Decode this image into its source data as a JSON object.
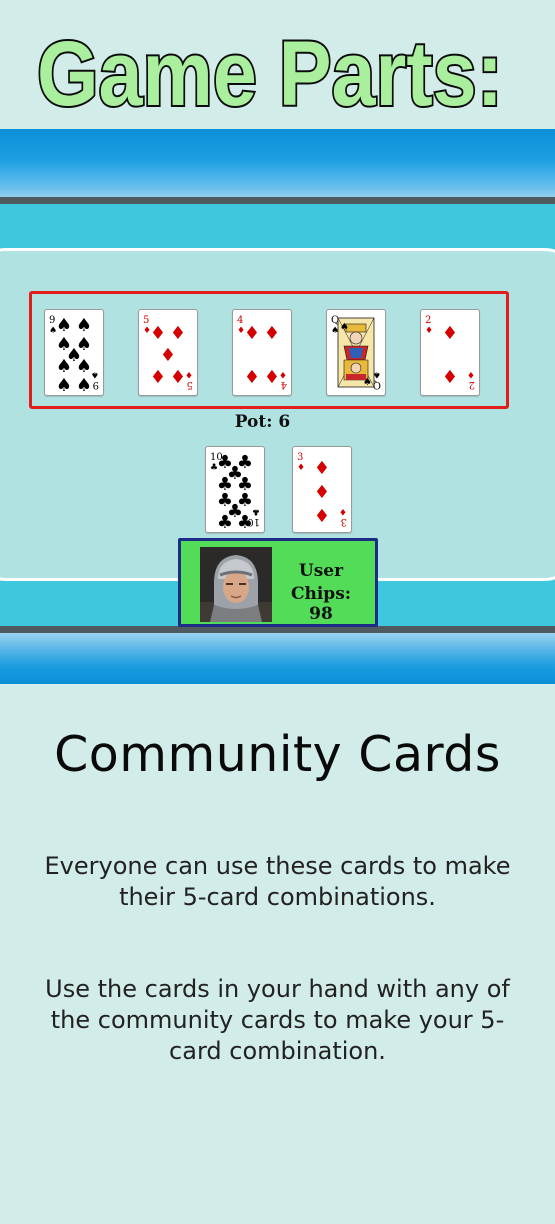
{
  "page": {
    "title": "Game Parts:"
  },
  "table": {
    "pot_label": "Pot: 6",
    "community_cards": [
      {
        "rank": "9",
        "suit": "spades",
        "suit_symbol": "♠",
        "color": "#000000"
      },
      {
        "rank": "5",
        "suit": "diamonds",
        "suit_symbol": "♦",
        "color": "#d40000"
      },
      {
        "rank": "4",
        "suit": "diamonds",
        "suit_symbol": "♦",
        "color": "#d40000"
      },
      {
        "rank": "Q",
        "suit": "spades",
        "suit_symbol": "♠",
        "color": "#000000"
      },
      {
        "rank": "2",
        "suit": "diamonds",
        "suit_symbol": "♦",
        "color": "#d40000"
      }
    ],
    "hand_cards": [
      {
        "rank": "10",
        "suit": "clubs",
        "suit_symbol": "♣",
        "color": "#000000"
      },
      {
        "rank": "3",
        "suit": "diamonds",
        "suit_symbol": "♦",
        "color": "#d40000"
      }
    ]
  },
  "player": {
    "name": "User",
    "chips_label": "Chips: 98"
  },
  "section": {
    "heading": "Community Cards",
    "paragraph1": "Everyone can use these cards to make their 5-card combinations.",
    "paragraph2": "Use the cards in your hand with any of the community cards to make your 5-card combination."
  },
  "colors": {
    "title_fill": "#a9ef9e",
    "community_border": "#e21b1b",
    "player_box_bg": "#52dc58",
    "player_box_border": "#1c2b86",
    "felt": "#b0e2e1",
    "page_bg": "#d2ecea"
  }
}
